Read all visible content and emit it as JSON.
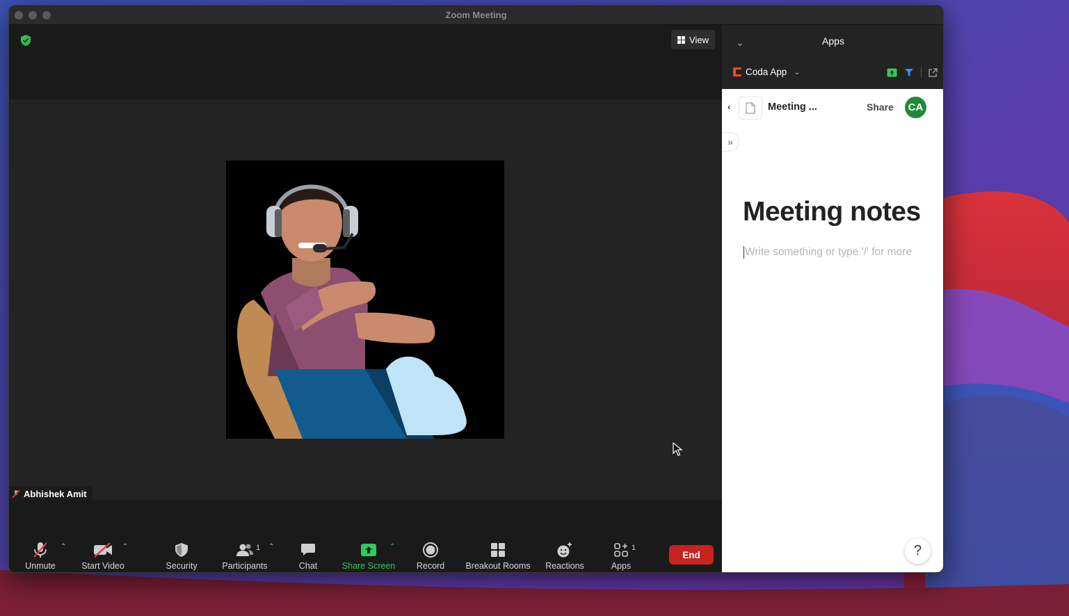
{
  "window": {
    "title": "Zoom Meeting"
  },
  "meeting": {
    "view_label": "View",
    "participant_name": "Abhishek Amit"
  },
  "toolbar": {
    "unmute": "Unmute",
    "start_video": "Start Video",
    "security": "Security",
    "participants": "Participants",
    "participants_count": "1",
    "chat": "Chat",
    "share_screen": "Share Screen",
    "record": "Record",
    "breakout_rooms": "Breakout Rooms",
    "reactions": "Reactions",
    "apps": "Apps",
    "apps_count": "1",
    "end": "End"
  },
  "apps_panel": {
    "title": "Apps",
    "app_name": "Coda App",
    "doc_title": "Meeting ...",
    "share_label": "Share",
    "avatar_initials": "CA",
    "heading": "Meeting notes",
    "placeholder": "Write something or type '/' for more",
    "help_label": "?"
  },
  "colors": {
    "accent_green": "#34c759",
    "end_red": "#c8231f",
    "avatar_green": "#1f8a3a",
    "coda_red": "#f04a2a"
  },
  "icons": [
    "shield-check-icon",
    "grid-view-icon",
    "mic-muted-icon",
    "video-off-icon",
    "security-shield-icon",
    "participants-icon",
    "chat-bubble-icon",
    "share-screen-icon",
    "record-icon",
    "breakout-rooms-icon",
    "reactions-icon",
    "apps-icon",
    "chevron-down-icon",
    "back-arrow-icon",
    "document-icon",
    "expand-icon",
    "help-icon",
    "mouse-cursor-icon"
  ]
}
